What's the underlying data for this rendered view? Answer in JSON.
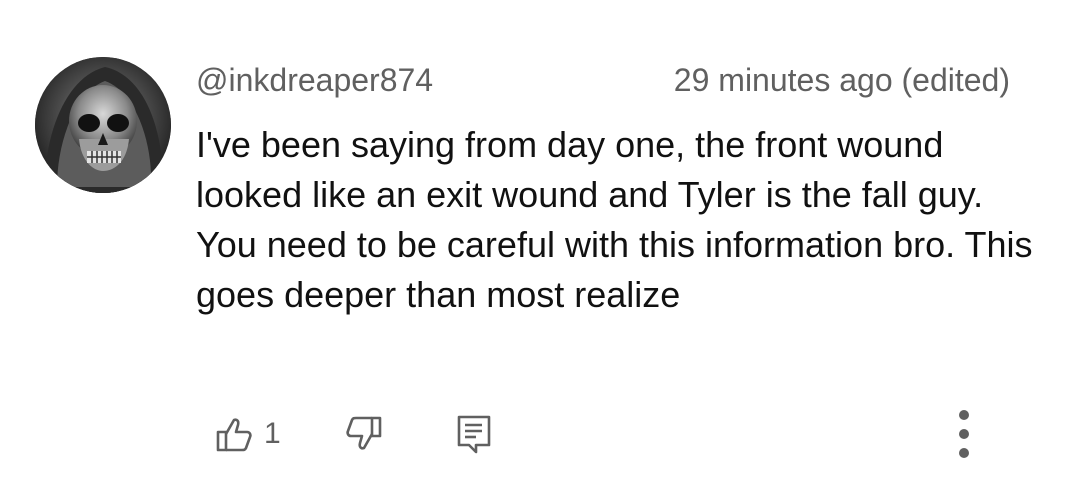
{
  "comment": {
    "author": "@inkdreaper874",
    "timestamp": "29 minutes ago (edited)",
    "text": "I've been saying from day one, the front wound looked like an exit wound and Tyler is the fall guy. You need to be careful with this information bro. This goes deeper than most realize",
    "avatar_icon": "skull-avatar",
    "actions": {
      "like_icon": "thumbs-up-icon",
      "like_count": "1",
      "dislike_icon": "thumbs-down-icon",
      "reply_icon": "reply-comment-icon",
      "more_icon": "more-vertical-icon"
    },
    "colors": {
      "meta_text": "#606060",
      "body_text": "#111111",
      "icon": "#606060"
    }
  }
}
